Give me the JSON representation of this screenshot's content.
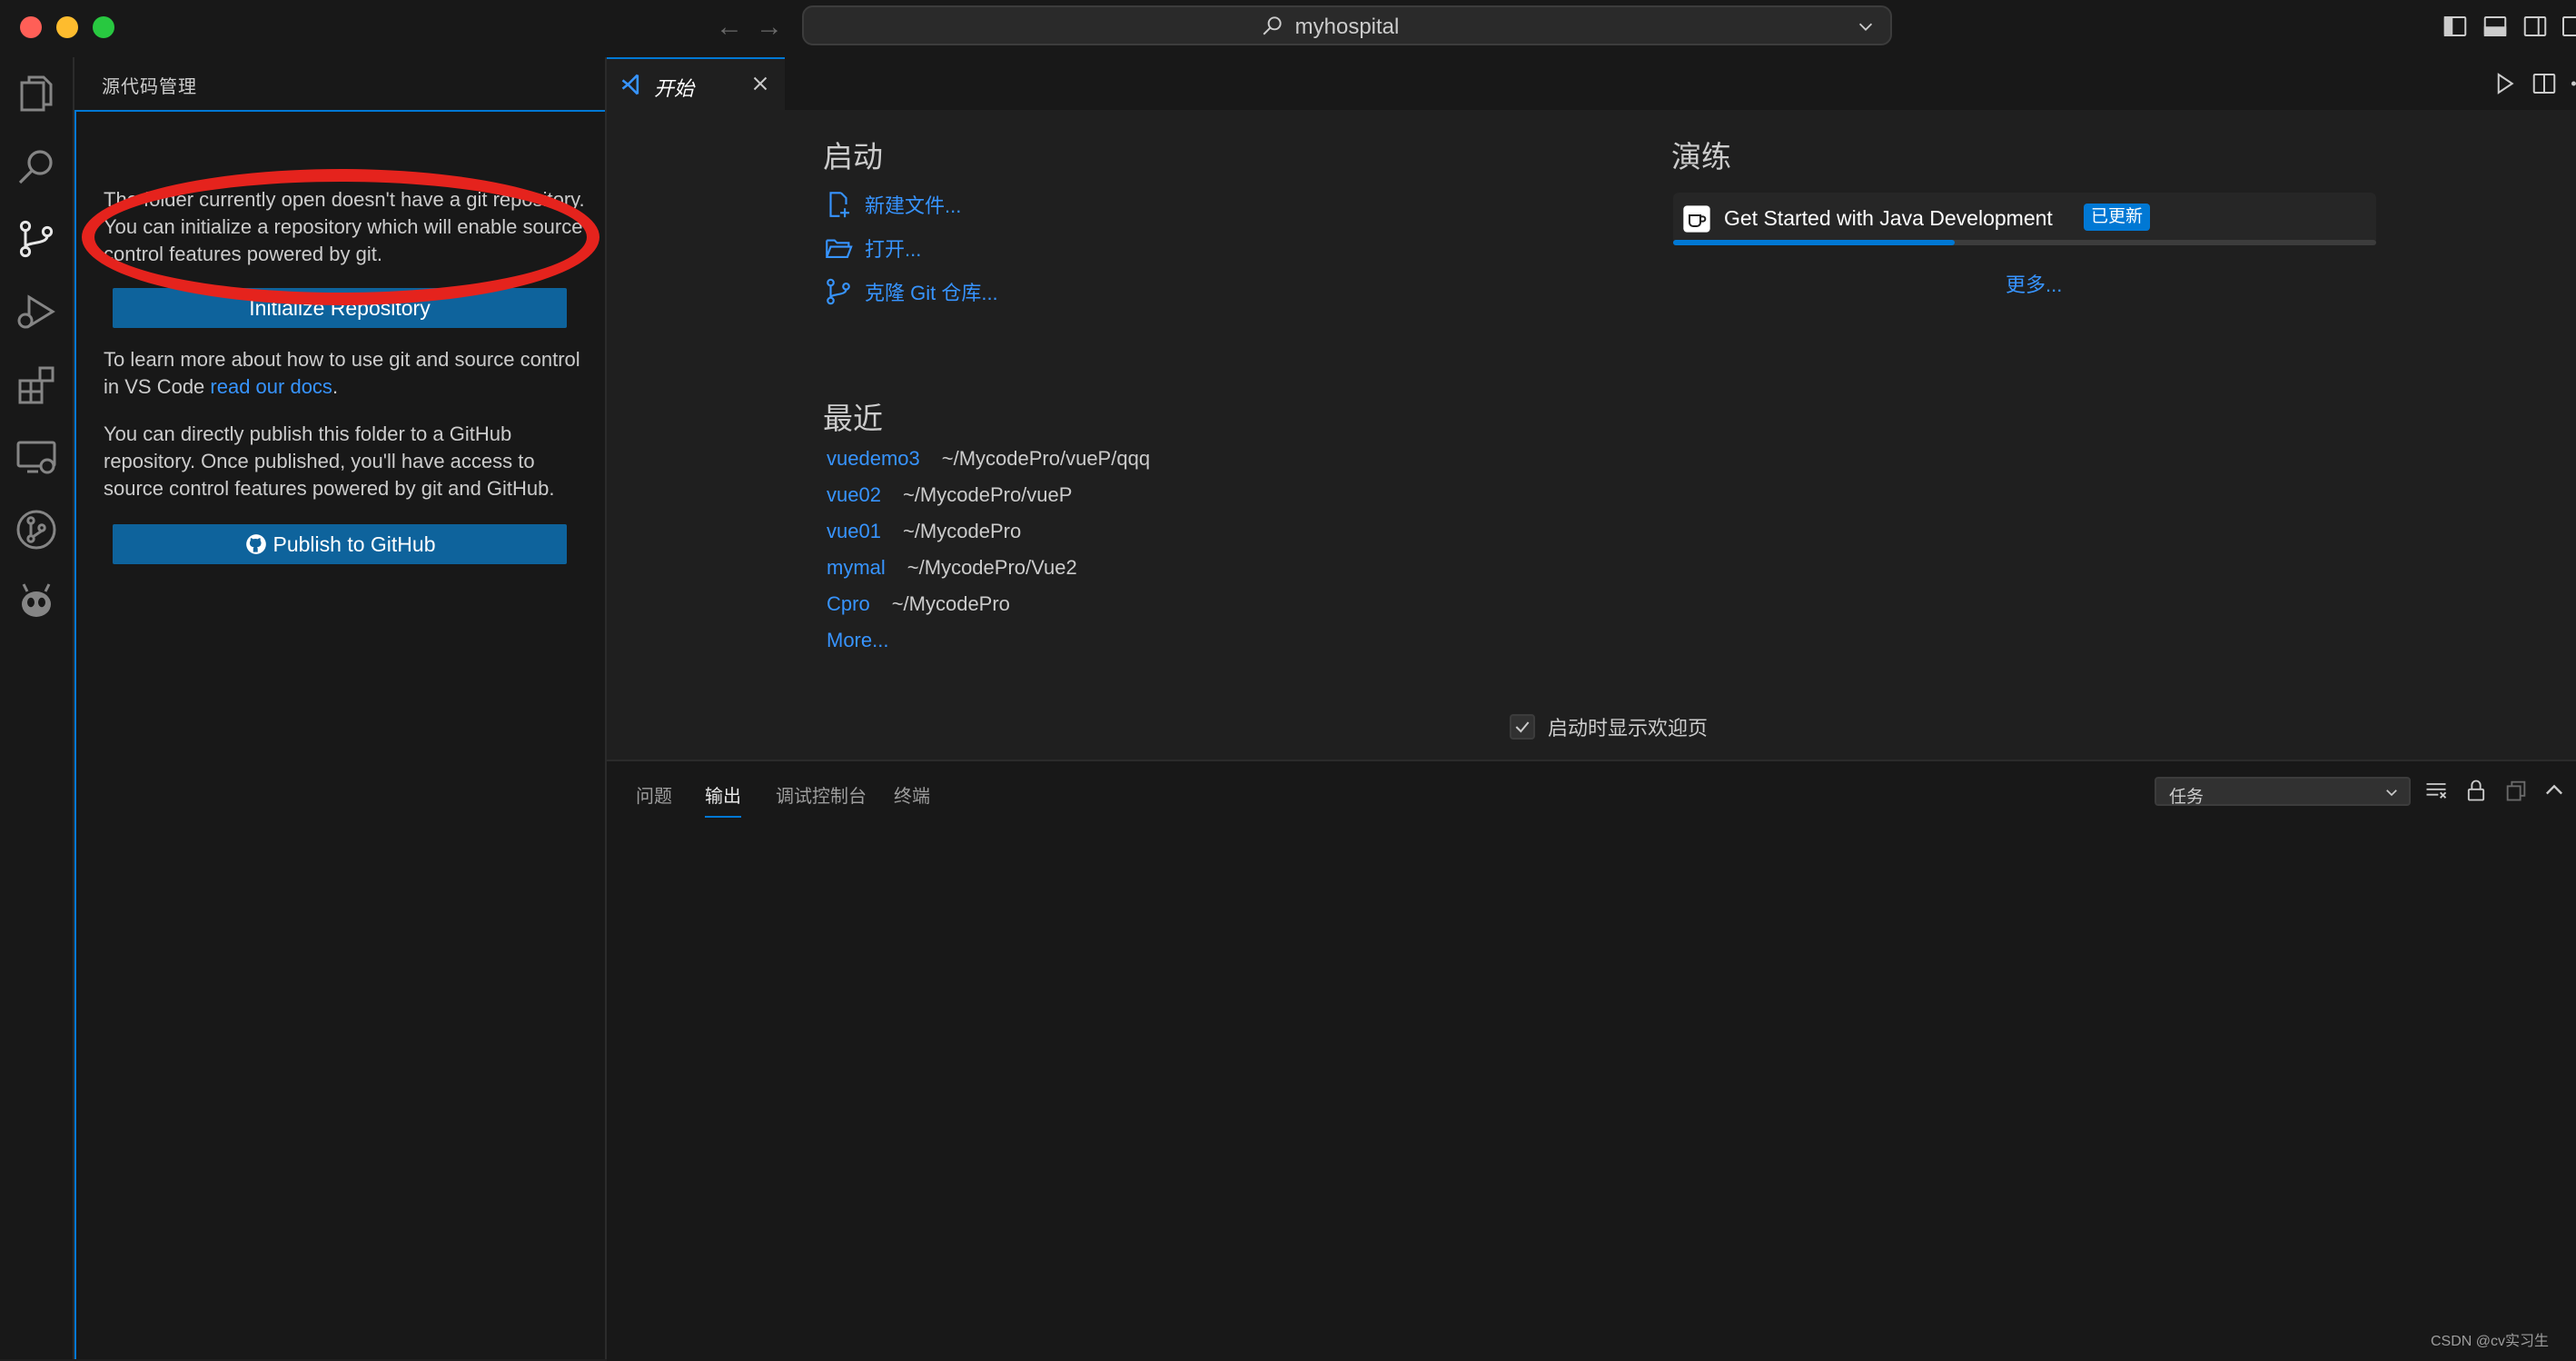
{
  "window": {
    "search_text": "myhospital"
  },
  "activity_bar": {
    "items": [
      "explorer",
      "search",
      "source-control",
      "run-debug",
      "extensions",
      "remote-explorer",
      "git-graph",
      "alien"
    ]
  },
  "sidebar": {
    "title": "源代码管理",
    "no_repo_text": "The folder currently open doesn't have a git repository. You can initialize a repository which will enable source control features powered by git.",
    "init_button": "Initialize Repository",
    "learn_prefix": "To learn more about how to use git and source control in VS Code ",
    "learn_link": "read our docs",
    "learn_suffix": ".",
    "publish_text": "You can directly publish this folder to a GitHub repository. Once published, you'll have access to source control features powered by git and GitHub.",
    "publish_button": "Publish to GitHub",
    "annotation_color": "#e5231d"
  },
  "editor": {
    "tab_label": "开始",
    "welcome": {
      "start_heading": "启动",
      "start_items": [
        "新建文件...",
        "打开...",
        "克隆 Git 仓库..."
      ],
      "walkthrough_heading": "演练",
      "walkthrough": {
        "title": "Get Started with Java Development",
        "badge": "已更新",
        "progress": 0.4
      },
      "more_walkthroughs": "更多...",
      "recent_heading": "最近",
      "recent": [
        {
          "name": "vuedemo3",
          "path": "~/MycodePro/vueP/qqq"
        },
        {
          "name": "vue02",
          "path": "~/MycodePro/vueP"
        },
        {
          "name": "vue01",
          "path": "~/MycodePro"
        },
        {
          "name": "mymal",
          "path": "~/MycodePro/Vue2"
        },
        {
          "name": "Cpro",
          "path": "~/MycodePro"
        }
      ],
      "more_recent": "More...",
      "show_on_startup": "启动时显示欢迎页",
      "show_on_startup_checked": true
    }
  },
  "panel": {
    "tabs": [
      "问题",
      "输出",
      "调试控制台",
      "终端"
    ],
    "active_tab": "输出",
    "task_select": "任务"
  },
  "watermark": "CSDN @cv实习生",
  "colors": {
    "accent": "#0078d4",
    "link": "#3794ff",
    "button": "#0e639c"
  }
}
